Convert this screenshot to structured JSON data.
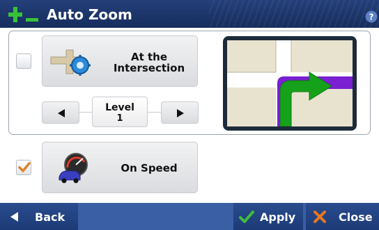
{
  "window": {
    "title": "Auto Zoom",
    "title_icon": "zoom-plus-minus-icon",
    "help_icon": "help-question-icon"
  },
  "options": {
    "intersection": {
      "label_line1": "At the",
      "label_line2": "Intersection",
      "checked": false,
      "icon": "intersection-zoom-gear-icon"
    },
    "level": {
      "label": "Level",
      "value": "1",
      "prev_icon": "arrow-left-icon",
      "next_icon": "arrow-right-icon"
    },
    "speed": {
      "label": "On Speed",
      "checked": true,
      "icon": "car-speedometer-icon"
    }
  },
  "preview": {
    "icon": "turn-right-arrow-map-icon",
    "colors": {
      "road": "#ffffff",
      "land": "#e8e3cf",
      "route": "#7a1fd1",
      "arrow": "#15a21a"
    }
  },
  "bottom_bar": {
    "back_label": "Back",
    "apply_label": "Apply",
    "close_label": "Close"
  },
  "colors": {
    "titlebar": "#1d3566",
    "bottombar": "#3a5fa5",
    "check": "#e0832a",
    "accent_green": "#2fb02a",
    "close_x": "#e8781e"
  }
}
